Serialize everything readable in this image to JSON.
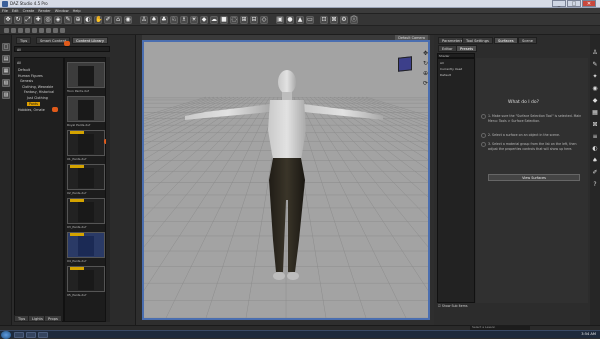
{
  "window": {
    "title": "DAZ Studio 4.5 Pro",
    "minimize": "_",
    "maximize": "□",
    "close": "✕"
  },
  "menu": [
    "File",
    "Edit",
    "Create",
    "Render",
    "Window",
    "Help"
  ],
  "toolbar": {
    "icons": [
      "move-icon",
      "rotate-icon",
      "scale-icon",
      "universal-icon",
      "select-icon",
      "node-icon",
      "surface-icon",
      "joint-icon",
      "region-icon",
      "spot-render-icon",
      "render-icon",
      "camera-icon"
    ]
  },
  "left_tabs": [
    {
      "label": "Tips"
    },
    {
      "label": "Smart Content"
    },
    {
      "label": "Content Library"
    }
  ],
  "left_dropdown": "All",
  "tree": [
    {
      "label": "All",
      "sel": false
    },
    {
      "label": "Default",
      "sel": false
    },
    {
      "label": "Human Figures",
      "sel": false
    },
    {
      "label": "Genesis",
      "sel": false
    },
    {
      "label": "Clothing, Wearable",
      "sel": false
    },
    {
      "label": "Fantasy, Historical",
      "sel": false
    },
    {
      "label": "Just Clothing",
      "sel": false
    },
    {
      "label": "Pants",
      "sel": true
    },
    {
      "label": "Hobbies, Ornate",
      "sel": false
    }
  ],
  "thumbs": [
    {
      "label": "Toon Pants.duf",
      "style": "light"
    },
    {
      "label": "Royal Pants.duf",
      "style": "light"
    },
    {
      "label": "01_Pants.duf",
      "style": "dark"
    },
    {
      "label": "02_Pants.duf",
      "style": "dark"
    },
    {
      "label": "03_Pants.duf",
      "style": "dark"
    },
    {
      "label": "04_Pants.duf",
      "style": "blue"
    },
    {
      "label": "05_Pants.duf",
      "style": "dark"
    }
  ],
  "left_bottom_tabs": [
    "Tips",
    "Lights",
    "Props"
  ],
  "viewport": {
    "camera": "Default Camera"
  },
  "right_tabs": [
    {
      "label": "Parameters"
    },
    {
      "label": "Tool Settings"
    },
    {
      "label": "Surfaces"
    },
    {
      "label": "Scene"
    }
  ],
  "right_subtabs": [
    {
      "label": "Editor"
    },
    {
      "label": "Presets"
    }
  ],
  "right_search": "Shader",
  "right_list": [
    "All",
    "Currently Used",
    "Default"
  ],
  "help": {
    "heading": "What do I do?",
    "steps": [
      "1. Make sure the \"Surface Selection Tool\" is selected. Main Menu: Tools > Surface Selection.",
      "2. Select a surface on an object in the scene.",
      "3. Select a material group from the list on the left, then adjust the properties controls that will show up here."
    ],
    "button": "View Surfaces"
  },
  "show_sub_items": "Show Sub Items",
  "lesson_placeholder": "Select a Lesson",
  "taskbar": {
    "clock": "3:54 AM"
  }
}
